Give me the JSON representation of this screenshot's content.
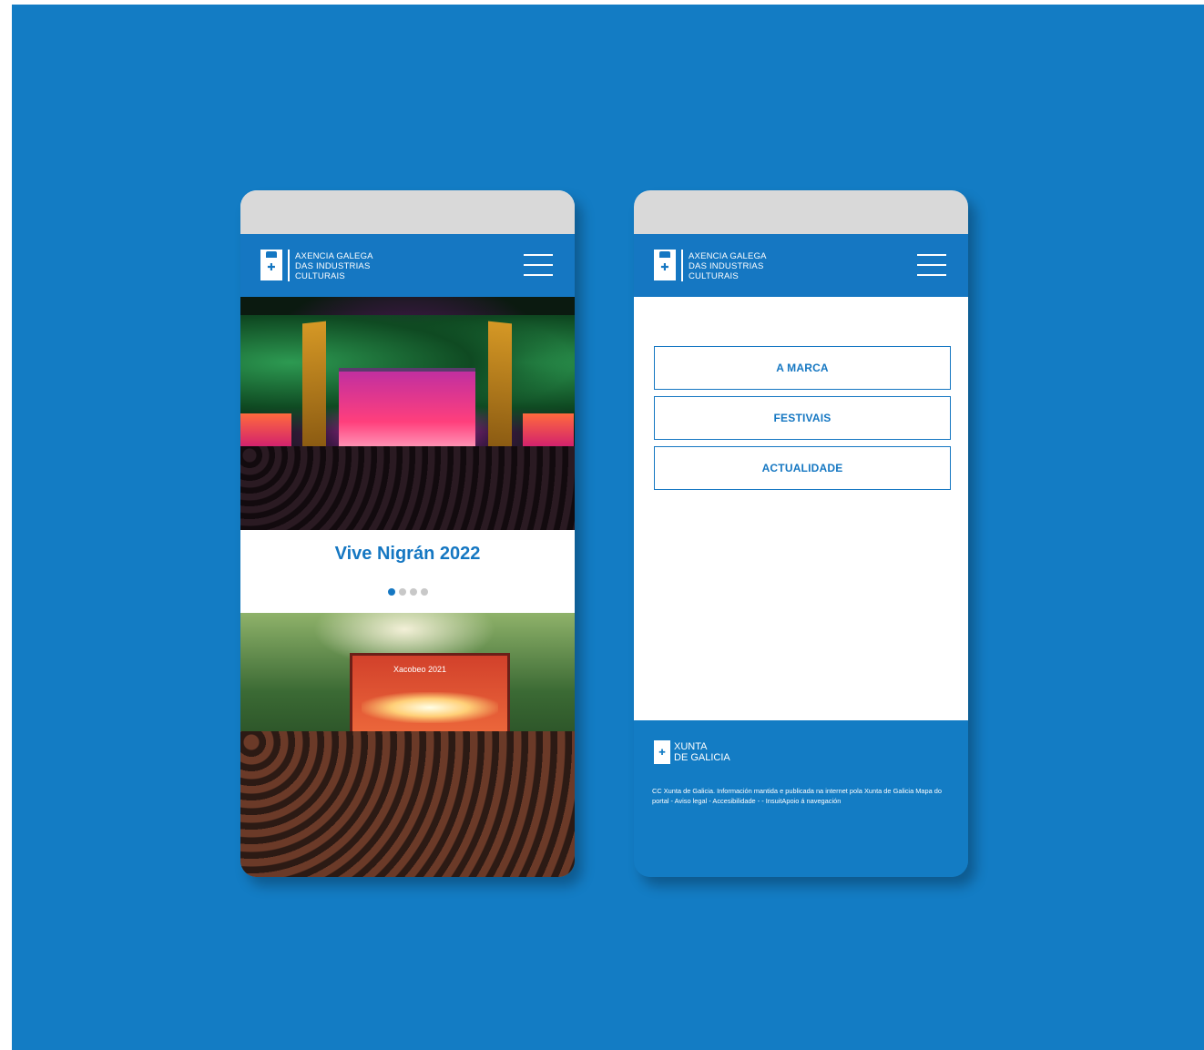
{
  "brand": {
    "line1": "AXENCIA GALEGA",
    "line2": "DAS INDUSTRIAS",
    "line3": "CULTURAIS"
  },
  "home": {
    "slide_title": "Vive Nigrán 2022",
    "slide_count": 4,
    "active_slide": 1,
    "banner2": "Xacobeo 2021"
  },
  "menu": {
    "items": [
      "A MARCA",
      "FESTIVAIS",
      "ACTUALIDADE"
    ]
  },
  "footer": {
    "logo_line1": "XUNTA",
    "logo_line2": "DE GALICIA",
    "legal": "CC Xunta de Galicia. Información mantida e publicada na internet pola Xunta de Galicia Mapa do portal - Aviso legal - Accesibilidade -  - InsuitApoio á navegación"
  },
  "colors": {
    "background": "#137cc4",
    "accent": "#1577c2",
    "statusbar": "#d9d9d9"
  }
}
